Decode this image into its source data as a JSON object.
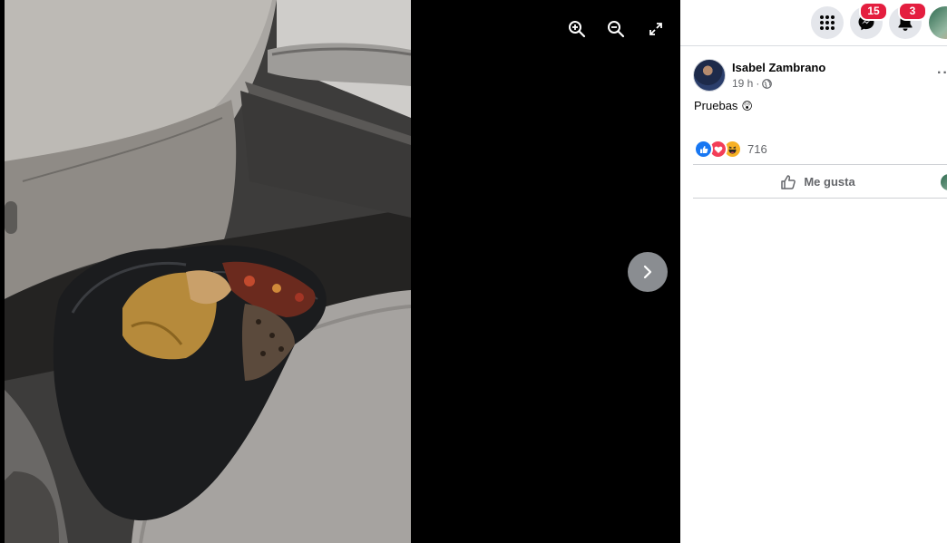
{
  "viewer": {
    "tools": [
      {
        "icon": "zoom-in-icon"
      },
      {
        "icon": "zoom-out-icon"
      },
      {
        "icon": "fullscreen-icon"
      }
    ],
    "next_icon": "chevron-right-icon"
  },
  "topbar": {
    "menu_icon": "grid-menu-icon",
    "messenger_badge": "15",
    "notifications_badge": "3"
  },
  "post": {
    "author": "Isabel Zambrano",
    "time": "19 h",
    "separator": "·",
    "audience_icon": "globe-icon",
    "text": "Pruebas",
    "emoji": "😲",
    "reactions": [
      "like",
      "love",
      "haha"
    ],
    "reaction_count": "716",
    "like_label": "Me gusta"
  },
  "colors": {
    "badge": "#e41e3f",
    "like_blue": "#1877f2",
    "love_red": "#f33e58",
    "haha_yellow": "#f7b125"
  }
}
